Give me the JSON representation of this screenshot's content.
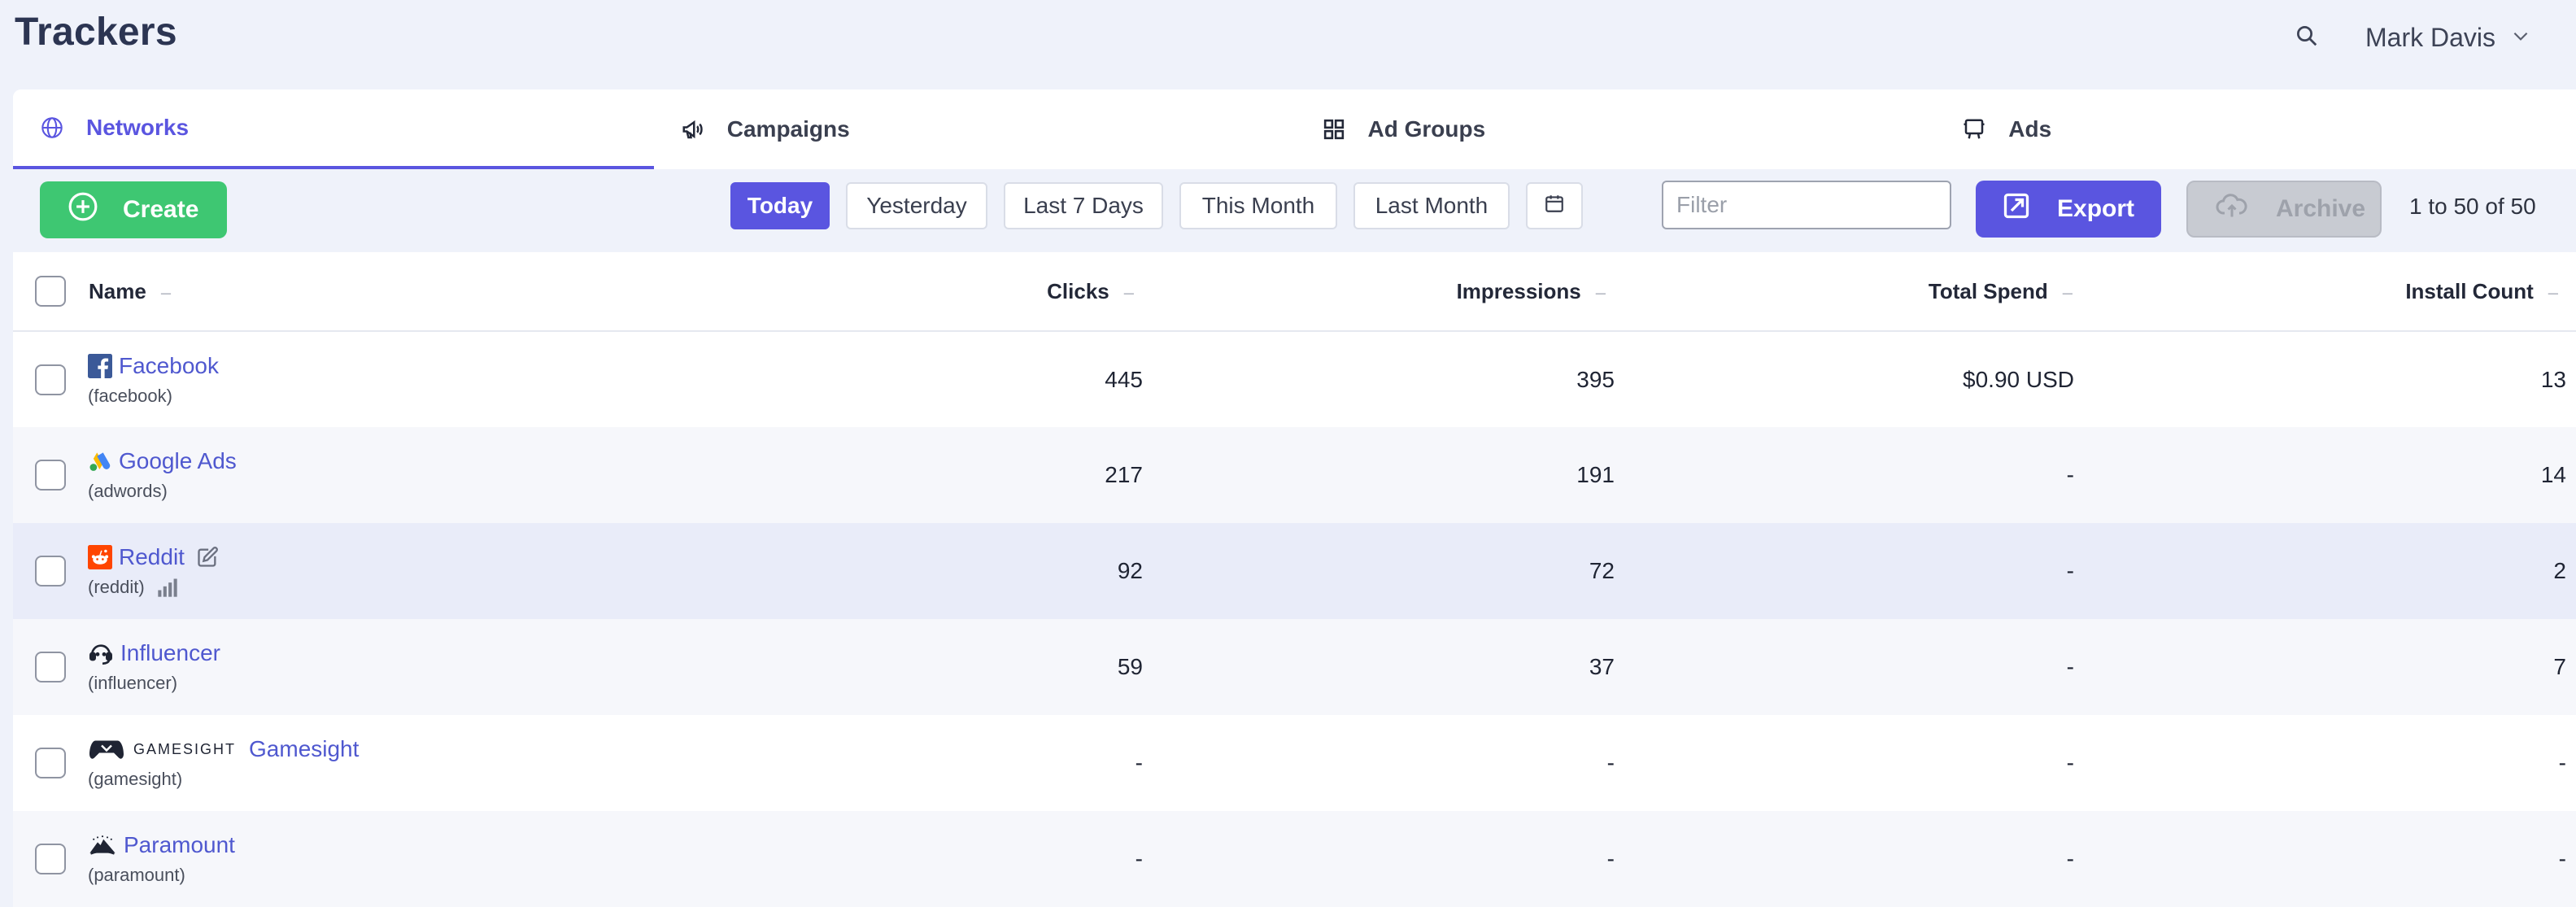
{
  "app": {
    "title": "Trackers",
    "user_name": "Mark Davis"
  },
  "tabs": [
    {
      "label": "Networks",
      "icon": "globe-icon",
      "active": true
    },
    {
      "label": "Campaigns",
      "icon": "megaphone-icon",
      "active": false
    },
    {
      "label": "Ad Groups",
      "icon": "grid-icon",
      "active": false
    },
    {
      "label": "Ads",
      "icon": "billboard-icon",
      "active": false
    }
  ],
  "toolbar": {
    "create_label": "Create",
    "ranges": [
      "Today",
      "Yesterday",
      "Last 7 Days",
      "This Month",
      "Last Month"
    ],
    "active_range": "Today",
    "filter_placeholder": "Filter",
    "export_label": "Export",
    "archive_label": "Archive",
    "paging": "1 to 50 of 50"
  },
  "table": {
    "columns": [
      "Name",
      "Clicks",
      "Impressions",
      "Total Spend",
      "Install Count"
    ],
    "rows": [
      {
        "name": "Facebook",
        "id": "(facebook)",
        "clicks": "445",
        "impressions": "395",
        "spend": "$0.90 USD",
        "installs": "13",
        "logo": "facebook-icon"
      },
      {
        "name": "Google Ads",
        "id": "(adwords)",
        "clicks": "217",
        "impressions": "191",
        "spend": "-",
        "installs": "14",
        "logo": "google-ads-icon"
      },
      {
        "name": "Reddit",
        "id": "(reddit)",
        "clicks": "92",
        "impressions": "72",
        "spend": "-",
        "installs": "2",
        "logo": "reddit-icon"
      },
      {
        "name": "Influencer",
        "id": "(influencer)",
        "clicks": "59",
        "impressions": "37",
        "spend": "-",
        "installs": "7",
        "logo": "headset-icon"
      },
      {
        "name": "Gamesight",
        "id": "(gamesight)",
        "clicks": "-",
        "impressions": "-",
        "spend": "-",
        "installs": "-",
        "logo": "gamesight-logo",
        "logo_text": "GAMESIGHT"
      },
      {
        "name": "Paramount",
        "id": "(paramount)",
        "clicks": "-",
        "impressions": "-",
        "spend": "-",
        "installs": "-",
        "logo": "paramount-icon"
      }
    ]
  },
  "colors": {
    "accent": "#5a55e0",
    "create": "#3ec772",
    "link": "#4f58cf",
    "background": "#eff2fa"
  }
}
